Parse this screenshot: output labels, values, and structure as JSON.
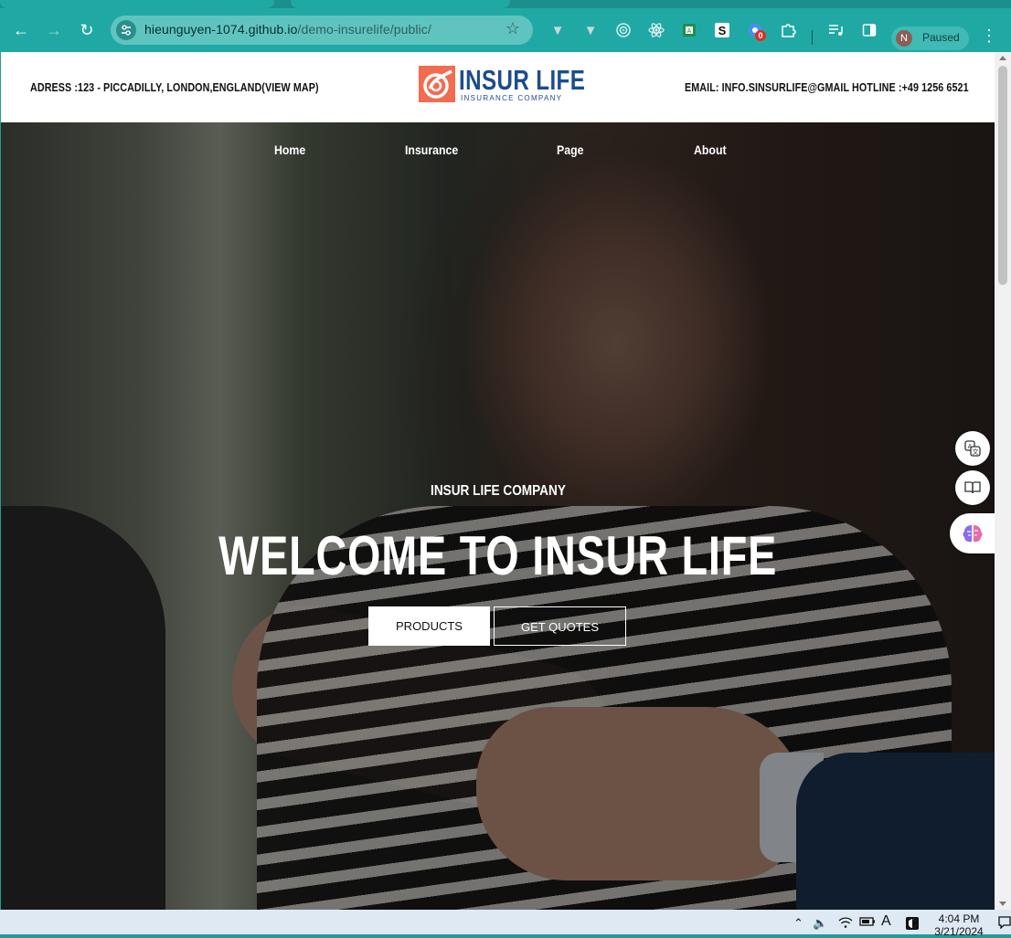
{
  "browser": {
    "url_host": "hieunguyen-1074.github.io",
    "url_path": "/demo-insurelife/public/",
    "profile_initial": "N",
    "profile_status": "Paused",
    "notification_badge": "0",
    "extension_s_label": "S"
  },
  "site": {
    "address": "ADRESS :123 - PICCADILLY, LONDON,ENGLAND(VIEW MAP)",
    "email": "EMAIL: INFO.SINSURLIFE@GMAIL",
    "hotline": "HOTLINE :+49 1256 6521",
    "logo_title": "INSUR LIFE",
    "logo_subtitle": "INSURANCE COMPANY",
    "menu": [
      "Home",
      "Insurance",
      "Page",
      "About"
    ],
    "hero": {
      "kicker": "INSUR LIFE COMPANY",
      "title": "WELCOME TO INSUR LIFE",
      "primary_button": "PRODUCTS",
      "secondary_button": "GET QUOTES"
    }
  },
  "taskbar": {
    "time": "4:04 PM",
    "date": "3/21/2024",
    "lang": "A"
  },
  "colors": {
    "browser_chrome": "#20a9a4",
    "logo_blue": "#1c4d8c",
    "logo_orange": "#f26c4f"
  }
}
